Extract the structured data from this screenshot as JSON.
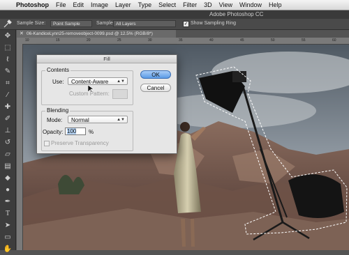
{
  "menubar": {
    "apple_icon": "apple-logo",
    "items": [
      "Photoshop",
      "File",
      "Edit",
      "Image",
      "Layer",
      "Type",
      "Select",
      "Filter",
      "3D",
      "View",
      "Window",
      "Help"
    ]
  },
  "window": {
    "title": "Adobe Photoshop CC"
  },
  "options_bar": {
    "sample_size_label": "Sample Size:",
    "sample_size_value": "Point Sample",
    "sample_label": "Sample:",
    "sample_value": "All Layers",
    "sampling_ring_label": "Show Sampling Ring",
    "sampling_ring_checked": true
  },
  "document": {
    "tab_label": "06-KandiceLynn25-removeobject-0099.psd @ 12.5% (RGB/8*)",
    "ruler_ticks": [
      "10",
      "15",
      "20",
      "25",
      "30",
      "35",
      "40",
      "45",
      "50",
      "55",
      "60"
    ]
  },
  "tools": [
    "move-icon",
    "marquee-icon",
    "lasso-icon",
    "quick-select-icon",
    "crop-icon",
    "eyedropper-icon",
    "healing-icon",
    "brush-icon",
    "stamp-icon",
    "history-brush-icon",
    "eraser-icon",
    "gradient-icon",
    "blur-icon",
    "dodge-icon",
    "pen-icon",
    "type-icon",
    "path-select-icon",
    "shape-icon",
    "hand-icon",
    "zoom-icon"
  ],
  "fill_dialog": {
    "title": "Fill",
    "contents_label": "Contents",
    "use_label": "Use:",
    "use_value": "Content-Aware",
    "custom_pattern_label": "Custom Pattern:",
    "blending_label": "Blending",
    "mode_label": "Mode:",
    "mode_value": "Normal",
    "opacity_label": "Opacity:",
    "opacity_value": "100",
    "opacity_unit": "%",
    "preserve_label": "Preserve Transparency",
    "ok_label": "OK",
    "cancel_label": "Cancel"
  },
  "colors": {
    "accent": "#5b9be6",
    "ui_dark": "#3d3d3d",
    "dialog_bg": "#e6e6e6"
  }
}
